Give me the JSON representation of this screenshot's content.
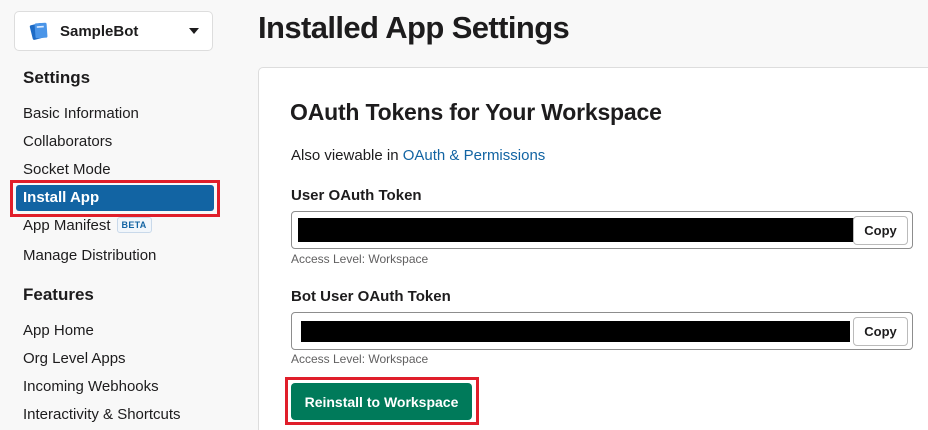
{
  "app_picker": {
    "name": "SampleBot"
  },
  "sidebar": {
    "settings_heading": "Settings",
    "settings_items": [
      {
        "label": "Basic Information"
      },
      {
        "label": "Collaborators"
      },
      {
        "label": "Socket Mode"
      },
      {
        "label": "Install App"
      },
      {
        "label": "App Manifest",
        "badge": "BETA"
      },
      {
        "label": "Manage Distribution"
      }
    ],
    "features_heading": "Features",
    "features_items": [
      {
        "label": "App Home"
      },
      {
        "label": "Org Level Apps"
      },
      {
        "label": "Incoming Webhooks"
      },
      {
        "label": "Interactivity & Shortcuts"
      }
    ],
    "active_item": "Install App"
  },
  "main": {
    "page_title": "Installed App Settings",
    "section_title": "OAuth Tokens for Your Workspace",
    "viewable_prefix": "Also viewable in",
    "viewable_link": "OAuth & Permissions",
    "user_token": {
      "label": "User OAuth Token",
      "copy_label": "Copy",
      "access_note": "Access Level: Workspace"
    },
    "bot_token": {
      "label": "Bot User OAuth Token",
      "copy_label": "Copy",
      "access_note": "Access Level: Workspace"
    },
    "reinstall_label": "Reinstall to Workspace"
  },
  "colors": {
    "active_nav": "#1264a3",
    "link": "#1264a3",
    "primary_button": "#007a5a",
    "highlight_box": "#e01e2a"
  },
  "icons": {
    "app_icon": "blue-notebook-icon",
    "picker_caret": "caret-down-icon"
  }
}
